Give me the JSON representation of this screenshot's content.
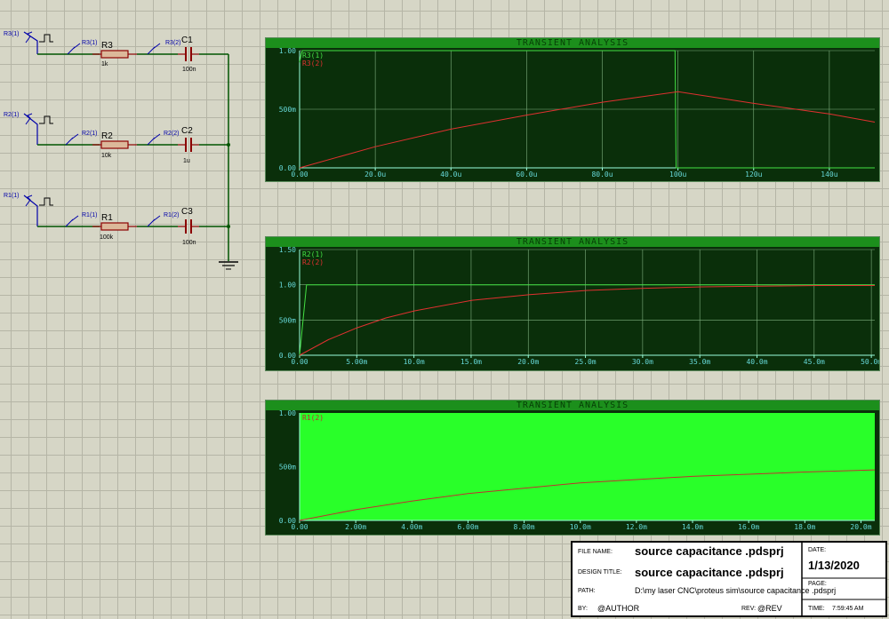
{
  "schematic": {
    "gens": [
      "R3(1)",
      "R2(1)",
      "R1(1)"
    ],
    "probes_left": [
      "R3(1)",
      "R2(1)",
      "R1(1)"
    ],
    "probes_right": [
      "R3(2)",
      "R2(2)",
      "R1(2)"
    ],
    "resistors": [
      {
        "ref": "R3",
        "value": "1k"
      },
      {
        "ref": "R2",
        "value": "10k"
      },
      {
        "ref": "R1",
        "value": "100k"
      }
    ],
    "capacitors": [
      {
        "ref": "C1",
        "value": "100n"
      },
      {
        "ref": "C2",
        "value": "1u"
      },
      {
        "ref": "C3",
        "value": "100n"
      }
    ],
    "colors": {
      "wire": "#005500",
      "component": "#8b0000",
      "probe": "#0000aa"
    }
  },
  "graphs": [
    {
      "title": "TRANSIENT ANALYSIS",
      "legend": [
        "R3(1)",
        "R3(2)"
      ],
      "y_ticks": [
        "1.00",
        "500m",
        "0.00"
      ],
      "x_ticks": [
        "0.00",
        "20.0u",
        "40.0u",
        "60.0u",
        "80.0u",
        "100u",
        "120u",
        "140u"
      ]
    },
    {
      "title": "TRANSIENT ANALYSIS",
      "legend": [
        "R2(1)",
        "R2(2)"
      ],
      "y_ticks": [
        "1.50",
        "1.00",
        "500m",
        "0.00"
      ],
      "x_ticks": [
        "0.00",
        "5.00m",
        "10.0m",
        "15.0m",
        "20.0m",
        "25.0m",
        "30.0m",
        "35.0m",
        "40.0m",
        "45.0m",
        "50.0m"
      ]
    },
    {
      "title": "TRANSIENT ANALYSIS",
      "legend": [
        "R1(2)"
      ],
      "y_ticks": [
        "1.00",
        "500m",
        "0.00"
      ],
      "x_ticks": [
        "0.00",
        "2.00m",
        "4.00m",
        "6.00m",
        "8.00m",
        "10.0m",
        "12.0m",
        "14.0m",
        "16.0m",
        "18.0m",
        "20.0m"
      ]
    }
  ],
  "chart_data": [
    {
      "type": "line",
      "title": "TRANSIENT ANALYSIS",
      "x_unit": "s",
      "xlim": [
        0,
        0.000152
      ],
      "ylim": [
        0,
        1.0
      ],
      "series": [
        {
          "name": "R3(1)",
          "color": "#44e044",
          "x": [
            0,
            5e-07,
            8e-07,
            9.92e-05,
            9.95e-05,
            0.000152
          ],
          "y": [
            0.9,
            0.98,
            1.0,
            1.0,
            0.0,
            0.0
          ]
        },
        {
          "name": "R3(2)",
          "color": "#e03030",
          "x": [
            0,
            2e-05,
            4e-05,
            6e-05,
            8e-05,
            0.0001,
            0.00012,
            0.00014,
            0.000152
          ],
          "y": [
            0,
            0.18,
            0.33,
            0.45,
            0.56,
            0.65,
            0.55,
            0.46,
            0.39
          ]
        }
      ]
    },
    {
      "type": "line",
      "title": "TRANSIENT ANALYSIS",
      "x_unit": "s",
      "xlim": [
        0,
        0.05
      ],
      "ylim": [
        0,
        1.5
      ],
      "series": [
        {
          "name": "R2(1)",
          "color": "#44e044",
          "x": [
            0,
            0.0006,
            0.05
          ],
          "y": [
            0,
            1.0,
            1.0
          ]
        },
        {
          "name": "R2(2)",
          "color": "#e03030",
          "x": [
            0,
            0.0025,
            0.005,
            0.0075,
            0.01,
            0.015,
            0.02,
            0.025,
            0.03,
            0.035,
            0.04,
            0.045,
            0.05
          ],
          "y": [
            0,
            0.22,
            0.39,
            0.53,
            0.63,
            0.78,
            0.86,
            0.92,
            0.95,
            0.97,
            0.98,
            0.99,
            0.99
          ]
        }
      ]
    },
    {
      "type": "line",
      "title": "TRANSIENT ANALYSIS",
      "x_unit": "s",
      "xlim": [
        0,
        0.0205
      ],
      "ylim": [
        0,
        1.0
      ],
      "series": [
        {
          "name": "R1(2)",
          "color": "#c03030",
          "x": [
            0,
            0.002,
            0.004,
            0.006,
            0.008,
            0.01,
            0.012,
            0.014,
            0.016,
            0.018,
            0.0205
          ],
          "y": [
            0,
            0.1,
            0.18,
            0.25,
            0.3,
            0.35,
            0.38,
            0.41,
            0.43,
            0.45,
            0.47
          ]
        }
      ]
    }
  ],
  "titleblock": {
    "file_name_label": "FILE NAME:",
    "file_name": "source capacitance .pdsprj",
    "design_title_label": "DESIGN TITLE:",
    "design_title": "source capacitance .pdsprj",
    "path_label": "PATH:",
    "path": "D:\\my laser CNC\\proteus sim\\source capacitance .pdsprj",
    "by_label": "BY:",
    "author": "@AUTHOR",
    "rev_label": "REV:",
    "rev": "@REV",
    "date_label": "DATE:",
    "date": "1/13/2020",
    "page_label": "PAGE:",
    "time_label": "TIME:",
    "time": "7:59:45 AM"
  }
}
